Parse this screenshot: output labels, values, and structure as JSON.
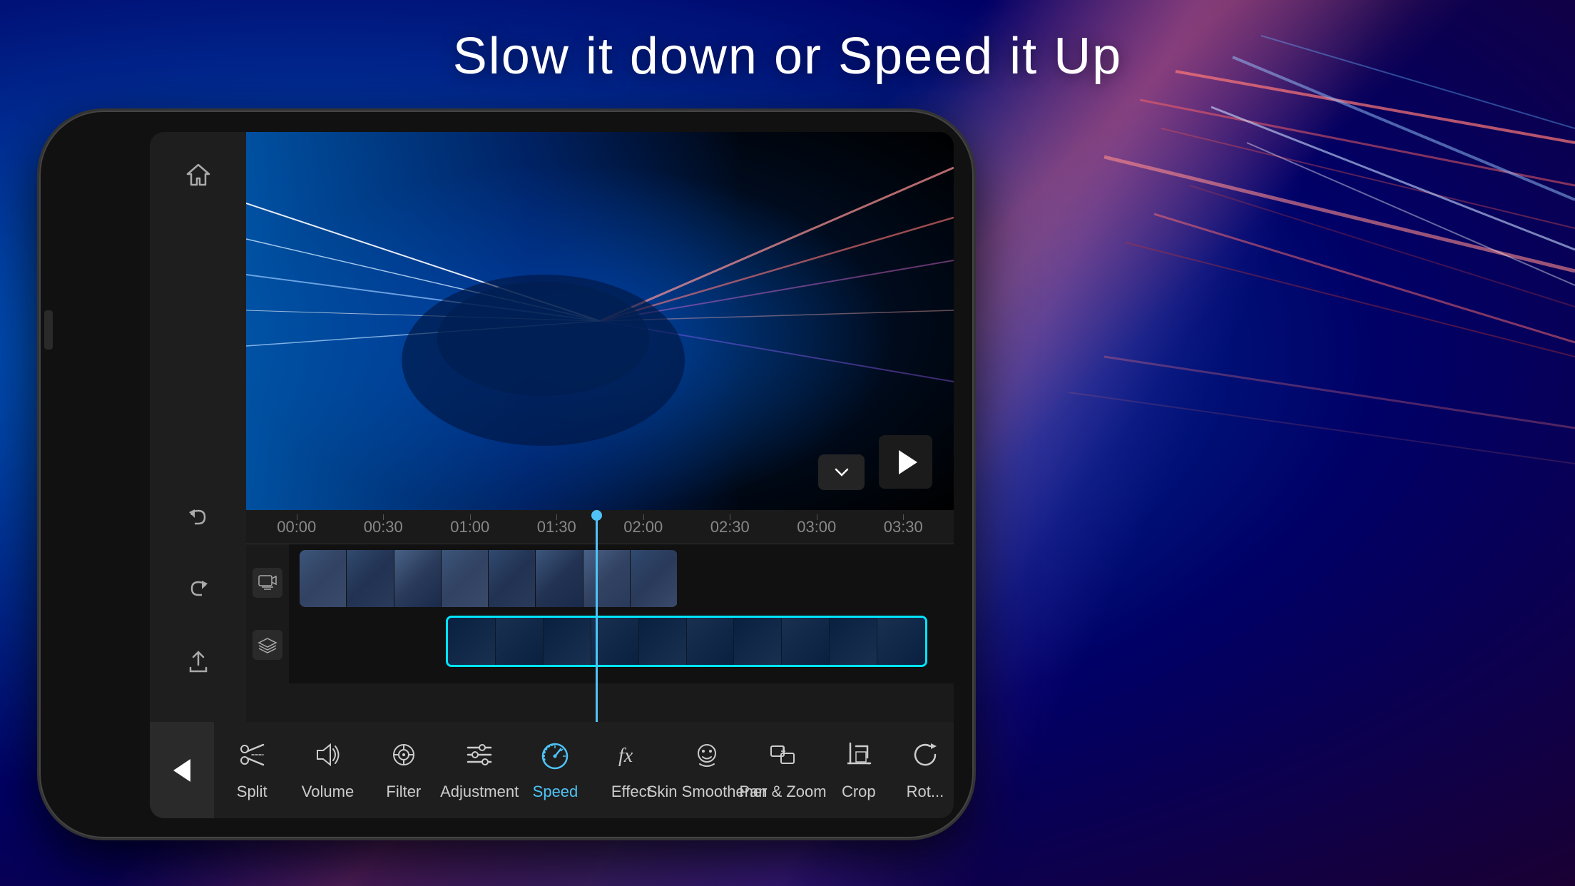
{
  "page": {
    "title": "Slow it down or Speed it Up",
    "background_color": "#1a1a2e"
  },
  "toolbar": {
    "back_label": "<",
    "items": [
      {
        "id": "split",
        "label": "Split",
        "icon": "scissors"
      },
      {
        "id": "volume",
        "label": "Volume",
        "icon": "volume"
      },
      {
        "id": "filter",
        "label": "Filter",
        "icon": "filter"
      },
      {
        "id": "adjustment",
        "label": "Adjustment",
        "icon": "adjustment"
      },
      {
        "id": "speed",
        "label": "Speed",
        "icon": "speed",
        "active": true
      },
      {
        "id": "effect",
        "label": "Effect",
        "icon": "fx"
      },
      {
        "id": "skin-smoothener",
        "label": "Skin Smoothener",
        "icon": "face"
      },
      {
        "id": "pan-zoom",
        "label": "Pan & Zoom",
        "icon": "pan-zoom"
      },
      {
        "id": "crop",
        "label": "Crop",
        "icon": "crop"
      },
      {
        "id": "rotate",
        "label": "Rot...",
        "icon": "rotate"
      }
    ]
  },
  "timeline": {
    "ruler_marks": [
      "00:00",
      "00:30",
      "01:00",
      "01:30",
      "02:00",
      "02:30",
      "03:00",
      "03:30"
    ],
    "playhead_position": "02:00"
  },
  "sidebar": {
    "items": [
      {
        "id": "home",
        "icon": "home"
      },
      {
        "id": "undo",
        "icon": "undo"
      },
      {
        "id": "redo",
        "icon": "redo"
      },
      {
        "id": "export",
        "icon": "export"
      },
      {
        "id": "delete",
        "icon": "delete"
      }
    ]
  }
}
